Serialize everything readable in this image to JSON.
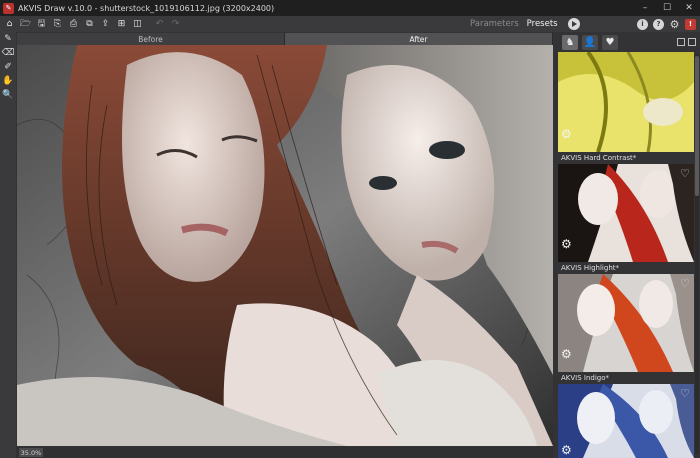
{
  "window": {
    "title": "AKVIS Draw v.10.0 - shutterstock_1019106112.jpg (3200x2400)",
    "controls": [
      "–",
      "☐",
      "✕"
    ]
  },
  "toolbar": {
    "tabs": {
      "parameters": "Parameters",
      "presets": "Presets"
    }
  },
  "compare": {
    "before": "Before",
    "after": "After"
  },
  "canvas": {
    "zoom": "35.0%"
  },
  "presets": [
    {
      "label": "",
      "tint": "yellow"
    },
    {
      "label": "AKVIS Hard Contrast*",
      "tint": "contrast"
    },
    {
      "label": "AKVIS Highlight*",
      "tint": "highlight"
    },
    {
      "label": "AKVIS Indigo*",
      "tint": "indigo"
    }
  ],
  "colors": {
    "accent_red": "#c23a34",
    "panel_bg": "#333335",
    "toolbar_bg": "#3a3a3c"
  }
}
